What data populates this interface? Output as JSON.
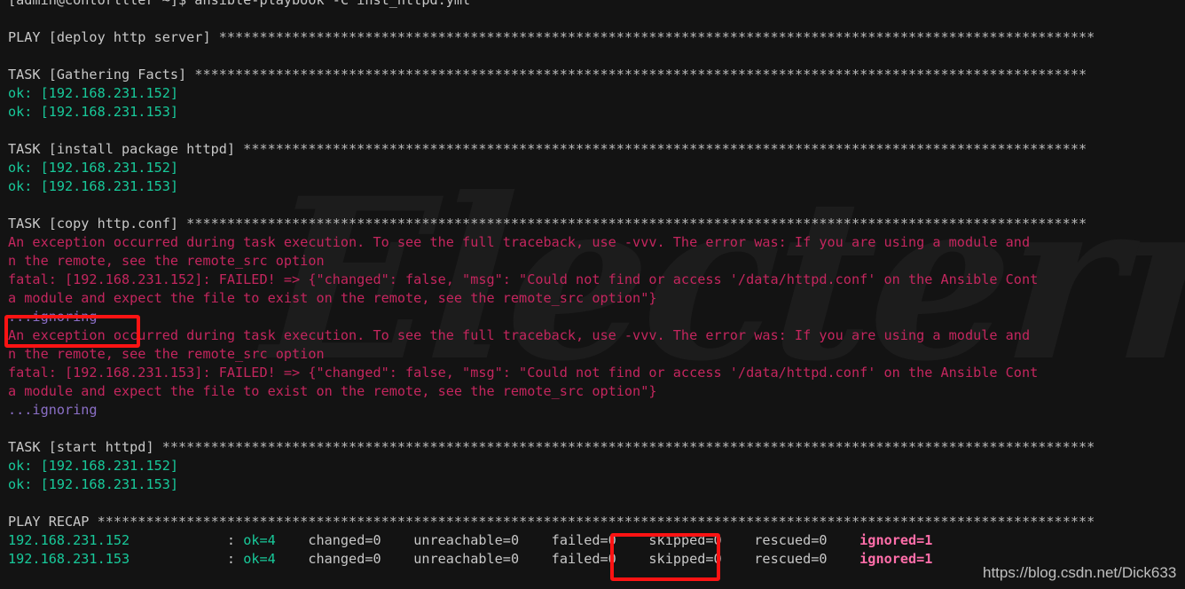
{
  "terminal": {
    "background_color": "#131313",
    "default_text_color": "#c8c8c8",
    "ok_color": "#18c99a",
    "error_color": "#c4265e",
    "ignoring_color": "#8b6fc7",
    "ignored_color": "#ff6ea9",
    "annotation_box_color": "#fc1313",
    "clipped_top_row": "      .                                                    .                   .        .",
    "watermark_text": "Electerm",
    "url_watermark": "https://blog.csdn.net/Dick633"
  },
  "prompt": {
    "user_host": "[admin@contorlller ~]$",
    "command": "ansible-playbook -C inst_httpd.yml",
    "full_line": "[admin@contorlller ~]$ ansible-playbook -C inst_httpd.yml"
  },
  "play": {
    "header": "PLAY [deploy http server] ",
    "stars": "************************************************************************************************************"
  },
  "tasks": [
    {
      "header": "TASK [Gathering Facts] ",
      "stars": "**************************************************************************************************************",
      "results": [
        "ok: [192.168.231.152]",
        "ok: [192.168.231.153]"
      ]
    },
    {
      "header": "TASK [install package httpd] ",
      "stars": "********************************************************************************************************",
      "results": [
        "ok: [192.168.231.152]",
        "ok: [192.168.231.153]"
      ]
    },
    {
      "header": "TASK [copy http.conf] ",
      "stars": "***************************************************************************************************************",
      "results": []
    },
    {
      "header": "TASK [start httpd] ",
      "stars": "*******************************************************************************************************************",
      "results": [
        "ok: [192.168.231.152]",
        "ok: [192.168.231.153]"
      ]
    }
  ],
  "errors": [
    {
      "exception_line": "An exception occurred during task execution. To see the full traceback, use -vvv. The error was: If you are using a module and",
      "wrap_line": "n the remote, see the remote_src option",
      "fatal_line": "fatal: [192.168.231.152]: FAILED! => {\"changed\": false, \"msg\": \"Could not find or access '/data/httpd.conf' on the Ansible Cont",
      "fatal_wrap": "a module and expect the file to exist on the remote, see the remote_src option\"}",
      "ignoring": "...ignoring"
    },
    {
      "exception_line": "An exception occurred during task execution. To see the full traceback, use -vvv. The error was: If you are using a module and",
      "wrap_line": "n the remote, see the remote_src option",
      "fatal_line": "fatal: [192.168.231.153]: FAILED! => {\"changed\": false, \"msg\": \"Could not find or access '/data/httpd.conf' on the Ansible Cont",
      "fatal_wrap": "a module and expect the file to exist on the remote, see the remote_src option\"}",
      "ignoring": "...ignoring"
    }
  ],
  "recap": {
    "header": "PLAY RECAP ",
    "stars": "***************************************************************************************************************************",
    "rows": [
      {
        "host": "192.168.231.152",
        "host_pad": "            ",
        "separator": ": ",
        "ok": "ok=4",
        "ok_pad": "    ",
        "changed": "changed=0",
        "changed_pad": "    ",
        "unreachable": "unreachable=0",
        "unreachable_pad": "    ",
        "failed": "failed=0",
        "failed_pad": "    ",
        "skipped": "skipped=0",
        "skipped_pad": "    ",
        "rescued": "rescued=0",
        "rescued_pad": "    ",
        "ignored": "ignored=1"
      },
      {
        "host": "192.168.231.153",
        "host_pad": "            ",
        "separator": ": ",
        "ok": "ok=4",
        "ok_pad": "    ",
        "changed": "changed=0",
        "changed_pad": "    ",
        "unreachable": "unreachable=0",
        "unreachable_pad": "    ",
        "failed": "failed=0",
        "failed_pad": "    ",
        "skipped": "skipped=0",
        "skipped_pad": "    ",
        "rescued": "rescued=0",
        "rescued_pad": "    ",
        "ignored": "ignored=1"
      }
    ]
  }
}
